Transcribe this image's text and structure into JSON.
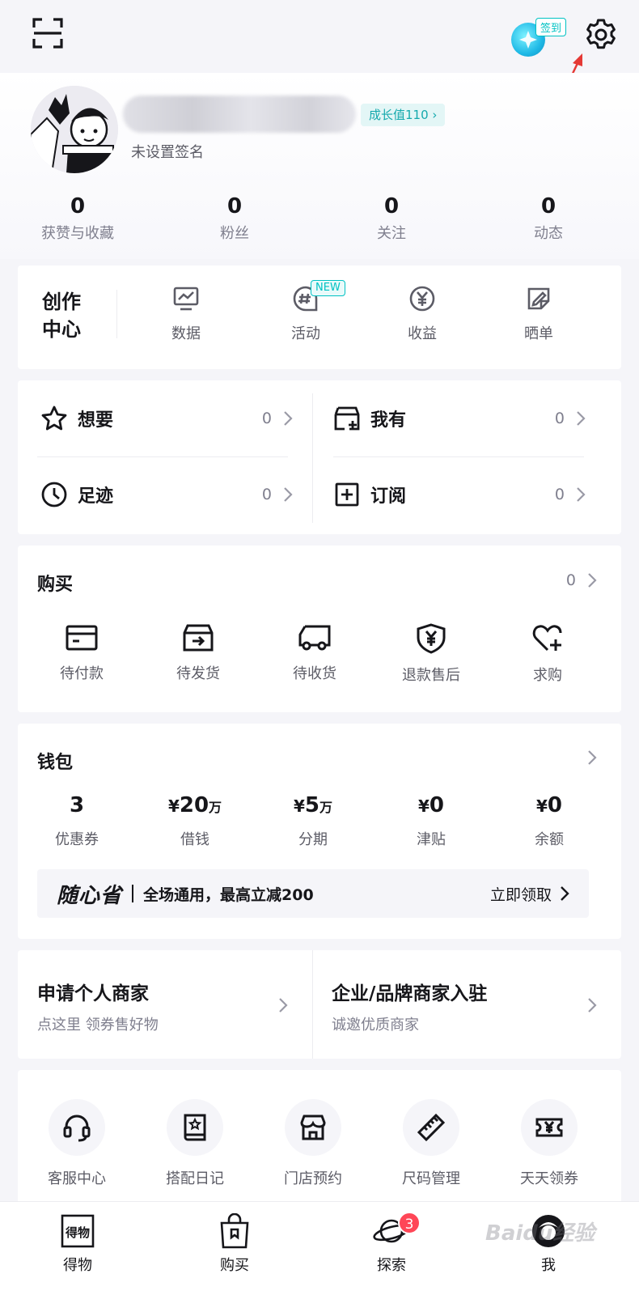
{
  "header": {
    "checkin_label": "签到"
  },
  "profile": {
    "growth_badge": "成长值110",
    "signature": "未设置签名",
    "stats": [
      {
        "value": "0",
        "label": "获赞与收藏"
      },
      {
        "value": "0",
        "label": "粉丝"
      },
      {
        "value": "0",
        "label": "关注"
      },
      {
        "value": "0",
        "label": "动态"
      }
    ]
  },
  "creator": {
    "title": "创作中心",
    "new_tag": "NEW",
    "items": [
      {
        "label": "数据",
        "icon": "chart-icon"
      },
      {
        "label": "活动",
        "icon": "hashtag-chat-icon"
      },
      {
        "label": "收益",
        "icon": "yuan-coin-icon"
      },
      {
        "label": "晒单",
        "icon": "edit-note-icon"
      }
    ]
  },
  "quick": {
    "want": {
      "label": "想要",
      "count": "0"
    },
    "have": {
      "label": "我有",
      "count": "0"
    },
    "footprint": {
      "label": "足迹",
      "count": "0"
    },
    "subscribe": {
      "label": "订阅",
      "count": "0"
    }
  },
  "purchase": {
    "title": "购买",
    "count": "0",
    "items": [
      {
        "label": "待付款",
        "icon": "card-icon"
      },
      {
        "label": "待发货",
        "icon": "box-icon"
      },
      {
        "label": "待收货",
        "icon": "truck-icon"
      },
      {
        "label": "退款售后",
        "icon": "shield-yuan-icon"
      },
      {
        "label": "求购",
        "icon": "heart-plus-icon"
      }
    ]
  },
  "wallet": {
    "title": "钱包",
    "items": [
      {
        "prefix": "",
        "value": "3",
        "unit": "",
        "label": "优惠券"
      },
      {
        "prefix": "¥",
        "value": "20",
        "unit": "万",
        "label": "借钱"
      },
      {
        "prefix": "¥",
        "value": "5",
        "unit": "万",
        "label": "分期"
      },
      {
        "prefix": "¥",
        "value": "0",
        "unit": "",
        "label": "津贴"
      },
      {
        "prefix": "¥",
        "value": "0",
        "unit": "",
        "label": "余额"
      }
    ],
    "promo": {
      "brand": "随心省",
      "text": "全场通用，最高立减200",
      "cta": "立即领取"
    }
  },
  "merchant": {
    "personal": {
      "title": "申请个人商家",
      "subtitle": "点这里 领券售好物"
    },
    "enterprise": {
      "title": "企业/品牌商家入驻",
      "subtitle": "诚邀优质商家"
    }
  },
  "services": [
    {
      "label": "客服中心",
      "icon": "headset-icon"
    },
    {
      "label": "搭配日记",
      "icon": "diary-icon"
    },
    {
      "label": "门店预约",
      "icon": "store-icon"
    },
    {
      "label": "尺码管理",
      "icon": "ruler-icon"
    },
    {
      "label": "天天领券",
      "icon": "ticket-icon"
    }
  ],
  "tabbar": {
    "items": [
      {
        "label": "得物",
        "icon": "dewu-logo-icon"
      },
      {
        "label": "购买",
        "icon": "shopping-bag-icon"
      },
      {
        "label": "探索",
        "icon": "planet-icon",
        "badge": "3"
      },
      {
        "label": "我",
        "icon": "me-avatar-icon"
      }
    ],
    "watermark": "Baidu经验"
  }
}
